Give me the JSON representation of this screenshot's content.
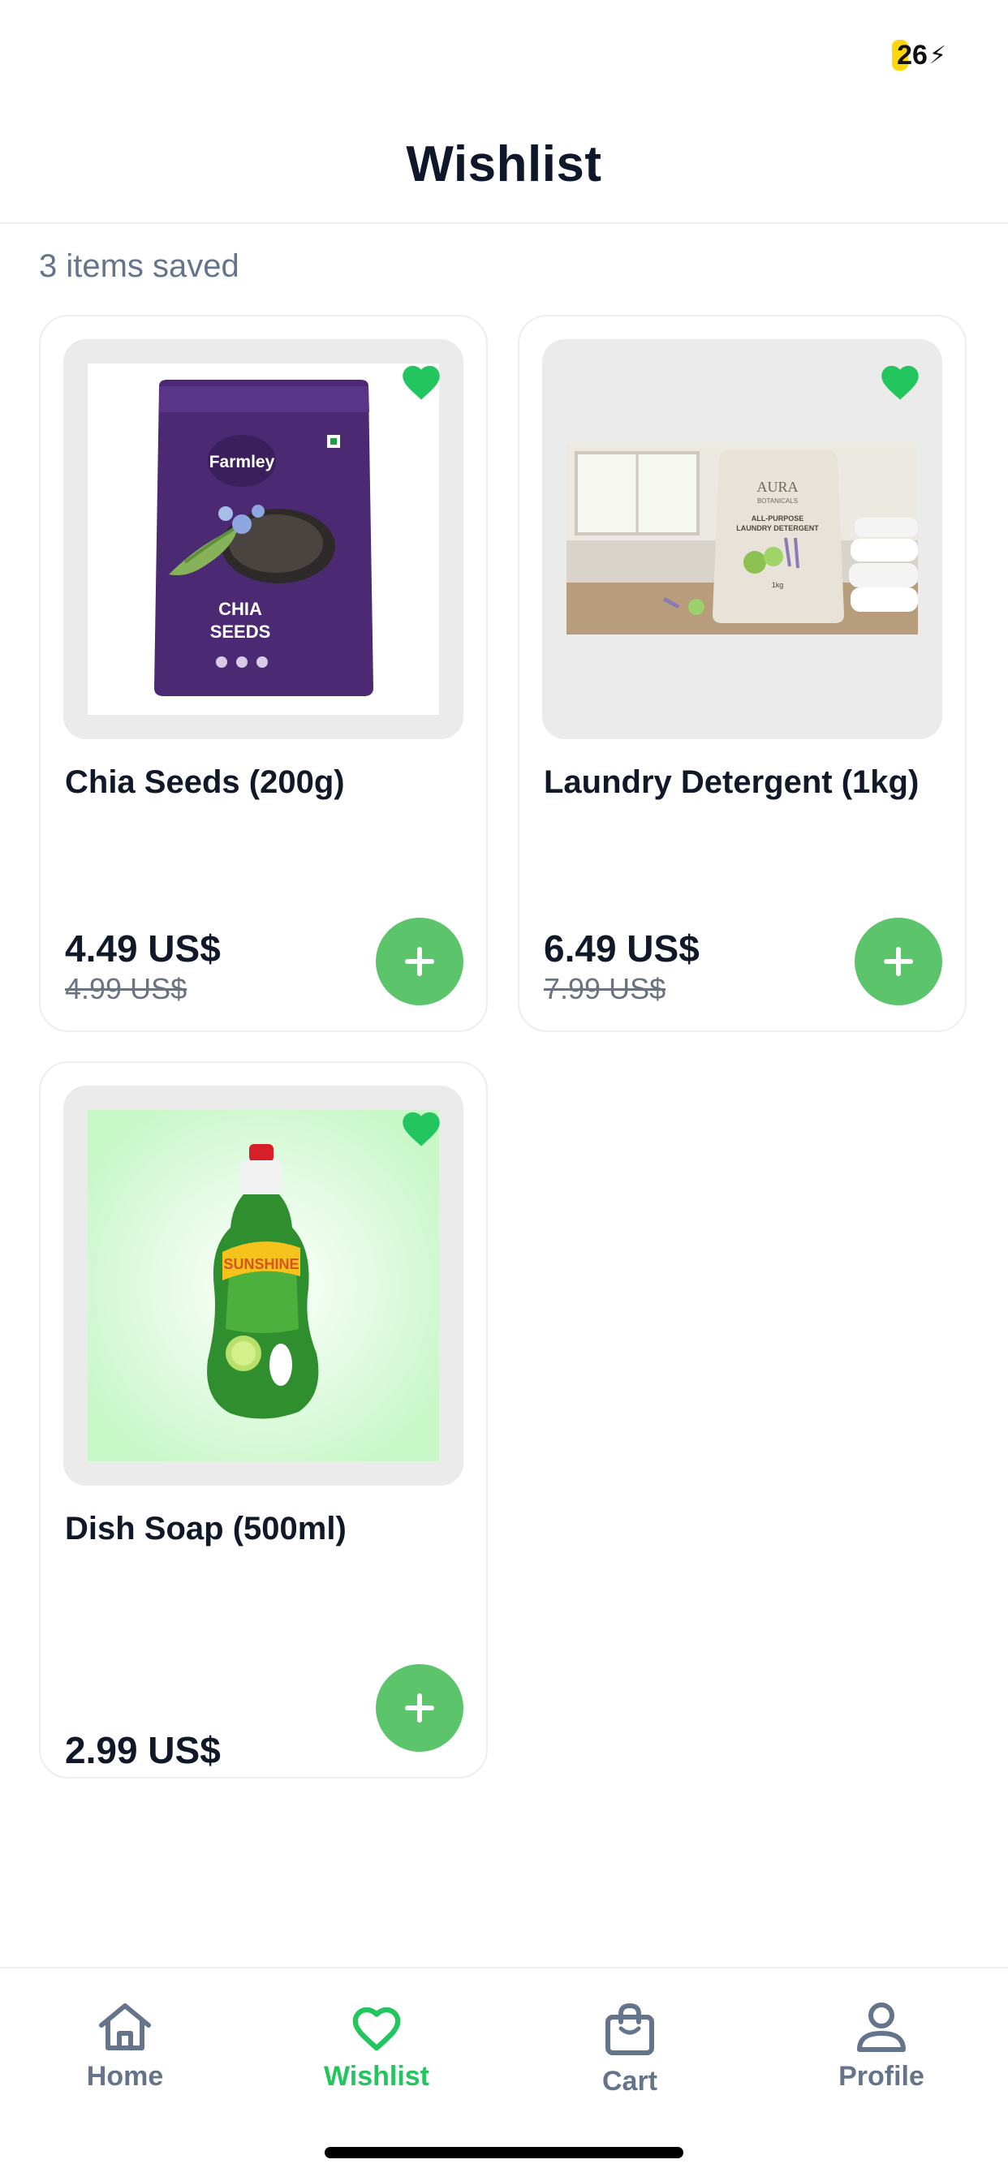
{
  "status_bar": {
    "battery": "26"
  },
  "header": {
    "title": "Wishlist"
  },
  "summary": {
    "count_text": "3 items saved"
  },
  "items": [
    {
      "name": "Chia Seeds (200g)",
      "price": "4.49 US$",
      "old_price": "4.99 US$",
      "image": {
        "brand": "Farmley",
        "line1": "CHIA",
        "line2": "SEEDS"
      }
    },
    {
      "name": "Laundry Detergent (1kg)",
      "price": "6.49 US$",
      "old_price": "7.99 US$",
      "image": {
        "brand": "AURA",
        "sub": "BOTANICALS",
        "line1": "ALL-PURPOSE",
        "line2": "LAUNDRY DETERGENT",
        "weight": "1kg"
      }
    },
    {
      "name": "Dish Soap (500ml)",
      "price": "2.99 US$",
      "image": {
        "brand": "SUNSHINE"
      }
    }
  ],
  "nav": [
    {
      "label": "Home",
      "icon": "home-icon"
    },
    {
      "label": "Wishlist",
      "icon": "heart-icon"
    },
    {
      "label": "Cart",
      "icon": "shopping-bag-icon"
    },
    {
      "label": "Profile",
      "icon": "user-icon"
    }
  ],
  "colors": {
    "accent": "#22c55e",
    "add_button": "#5cc46b",
    "muted": "#64748b"
  }
}
